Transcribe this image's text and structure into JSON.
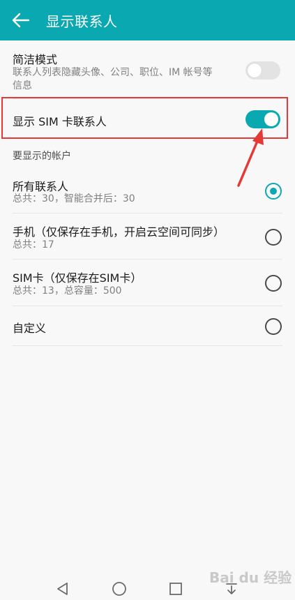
{
  "header": {
    "title": "显示联系人",
    "color": "#0aa8b0"
  },
  "settings": {
    "simple_mode": {
      "title": "简洁模式",
      "description_line1": "联系人列表隐藏头像、公司、职位、IM 帐号等",
      "description_line2": "信息",
      "enabled": false
    },
    "show_sim": {
      "title": "显示 SIM 卡联系人",
      "enabled": true
    }
  },
  "accounts_section": {
    "label": "要显示的帐户",
    "options": [
      {
        "title": "所有联系人",
        "subtitle": "总共：30，智能合并后：30",
        "selected": true
      },
      {
        "title": "手机（仅保存在手机，开启云空间可同步）",
        "subtitle": "总共：17",
        "selected": false
      },
      {
        "title": "SIM卡（仅保存在SIM卡）",
        "subtitle": "总共：13，总容量：500",
        "selected": false
      },
      {
        "title": "自定义",
        "subtitle": "",
        "selected": false
      }
    ]
  },
  "annotation_color": "#e53935",
  "watermark_text": "Bai du 经验"
}
